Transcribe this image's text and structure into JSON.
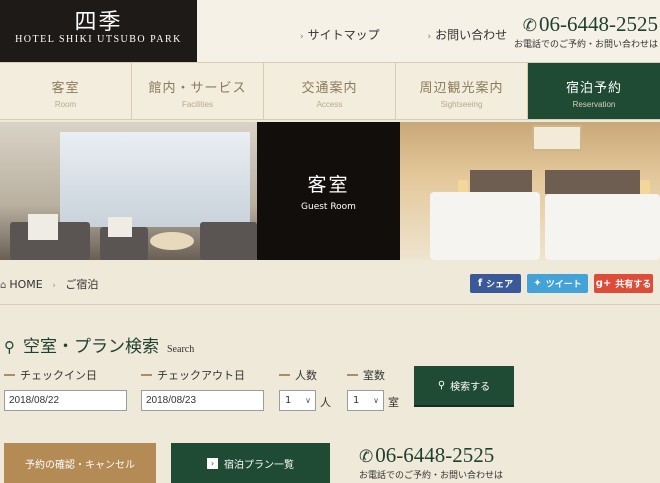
{
  "header": {
    "logo_kanji": "四季",
    "logo_name": "HOTEL SHIKI UTSUBO PARK",
    "links": [
      "サイトマップ",
      "お問い合わせ"
    ],
    "phone": "06-6448-2525",
    "phone_note": "お電話でのご予約・お問い合わせは"
  },
  "nav": [
    {
      "jp": "客室",
      "en": "Room"
    },
    {
      "jp": "館内・サービス",
      "en": "Facilities"
    },
    {
      "jp": "交通案内",
      "en": "Access"
    },
    {
      "jp": "周辺観光案内",
      "en": "Sightseeing"
    },
    {
      "jp": "宿泊予約",
      "en": "Reservation"
    }
  ],
  "hero": {
    "title": "客室",
    "subtitle": "Guest Room"
  },
  "breadcrumb": {
    "home": "HOME",
    "current": "ご宿泊"
  },
  "share": {
    "facebook": "シェア",
    "twitter": "ツイート",
    "gplus": "共有する"
  },
  "search": {
    "title": "空室・プラン検索",
    "title_en": "Search",
    "checkin_label": "チェックイン日",
    "checkout_label": "チェックアウト日",
    "guests_label": "人数",
    "rooms_label": "室数",
    "checkin_value": "2018/08/22",
    "checkout_value": "2018/08/23",
    "guests_value": "1",
    "guests_unit": "人",
    "rooms_value": "1",
    "rooms_unit": "室",
    "button": "検索する"
  },
  "actions": {
    "confirm": "予約の確認・キャンセル",
    "plans": "宿泊プラン一覧"
  },
  "colors": {
    "accent": "#1f4a33",
    "gold": "#b48a55",
    "bg": "#efe9d9"
  }
}
